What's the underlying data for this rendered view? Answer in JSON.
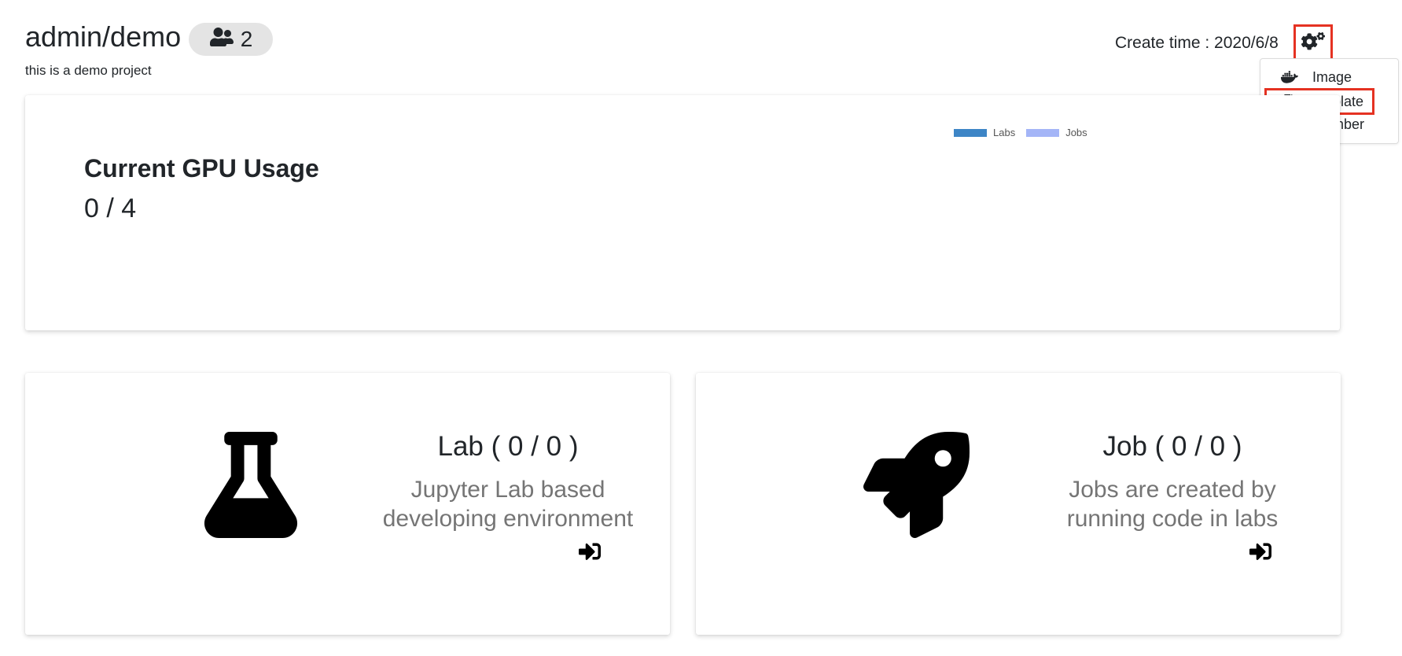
{
  "header": {
    "project_name": "admin/demo",
    "member_count": "2",
    "description": "this is a demo project",
    "create_time": "Create time : 2020/6/8"
  },
  "settings_menu": {
    "button_icon": "cogs-icon",
    "items": [
      {
        "label": "Image",
        "icon": "docker-icon"
      },
      {
        "label": "Template",
        "icon": "file-code-icon"
      },
      {
        "label": "Member",
        "icon": "users-icon"
      }
    ]
  },
  "gpu": {
    "title": "Current GPU Usage",
    "usage": "0 / 4",
    "legend": [
      {
        "label": "Labs",
        "color": "#3d85c6"
      },
      {
        "label": "Jobs",
        "color": "#a4b5f7"
      }
    ]
  },
  "lab": {
    "title": "Lab ( 0 / 0 )",
    "description_line1": "Jupyter Lab based",
    "description_line2": "developing environment",
    "icon": "flask-icon"
  },
  "job": {
    "title": "Job ( 0 / 0 )",
    "description_line1": "Jobs are created by",
    "description_line2": "running code in labs",
    "icon": "rocket-icon"
  },
  "colors": {
    "highlight": "#e53222",
    "muted_text": "#757575"
  }
}
